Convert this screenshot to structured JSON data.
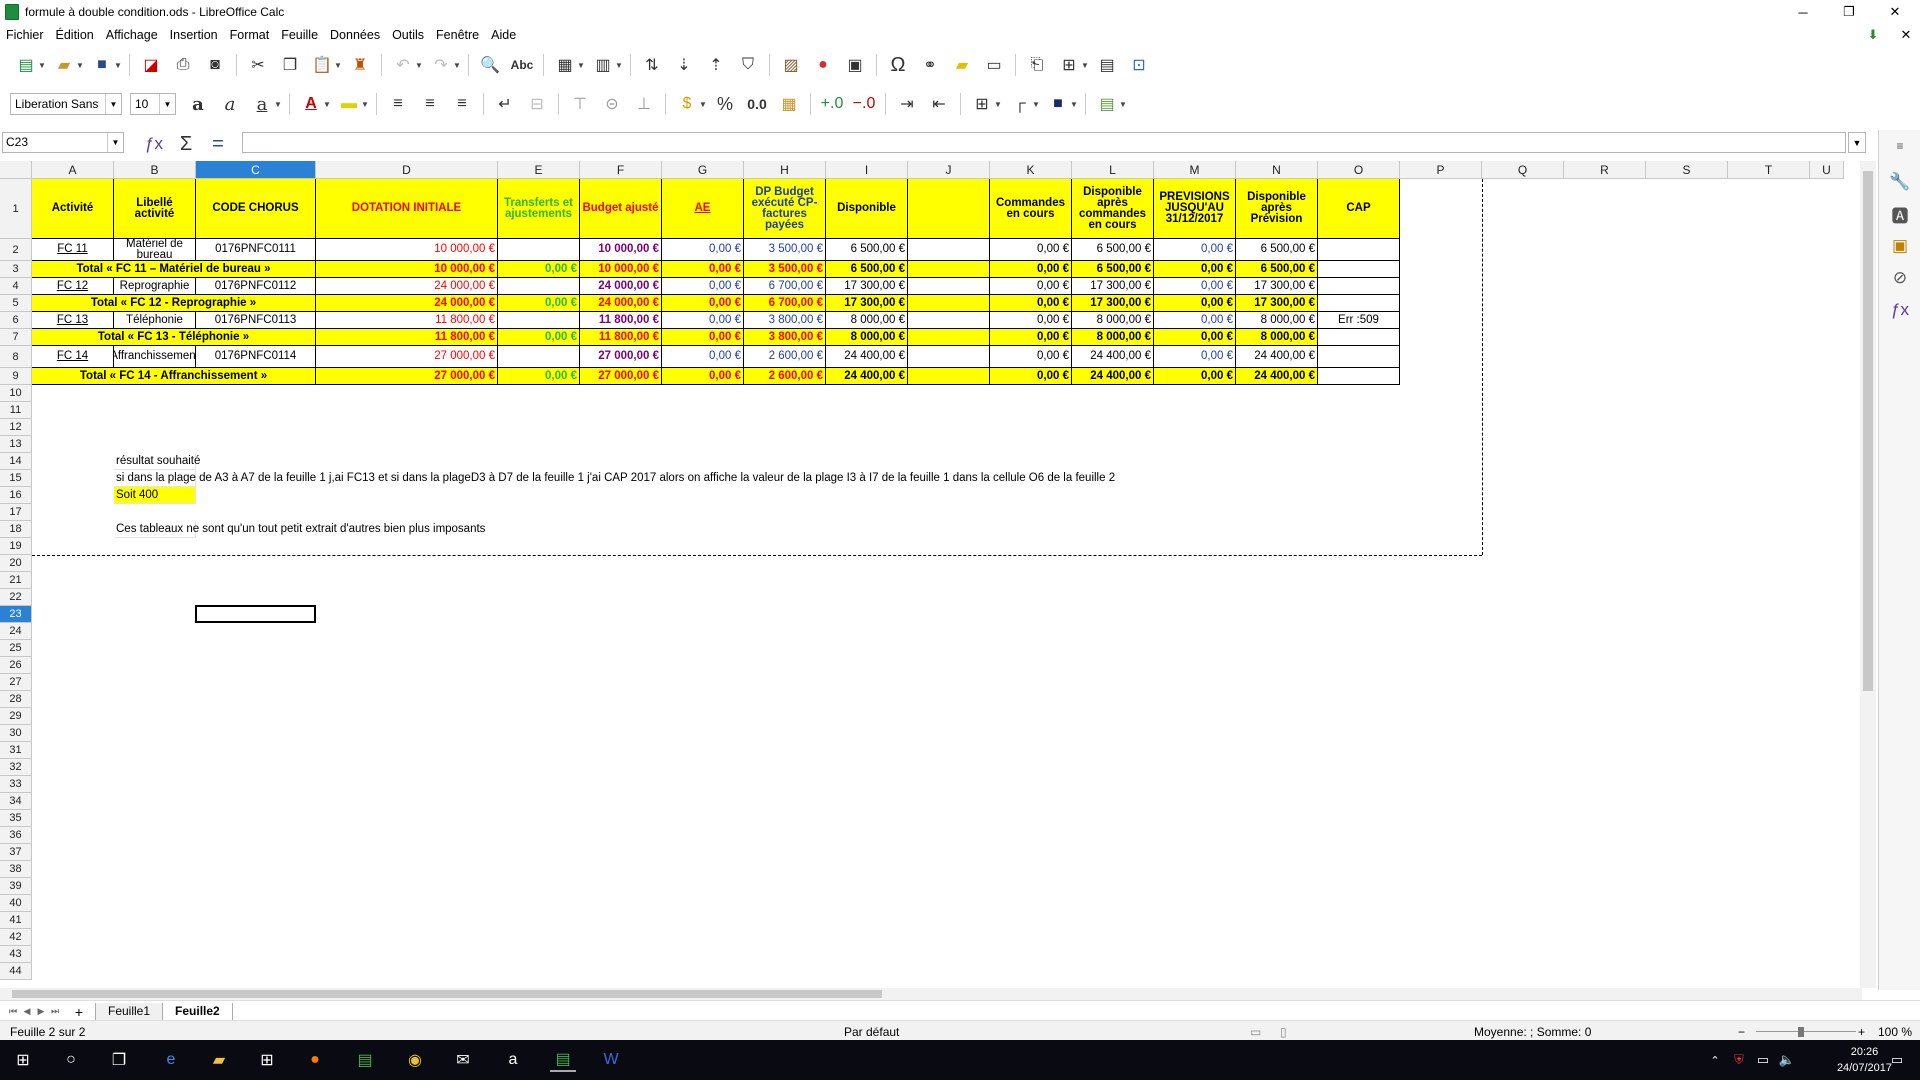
{
  "window": {
    "title": "formule à double condition.ods - LibreOffice Calc"
  },
  "menu": [
    "Fichier",
    "Édition",
    "Affichage",
    "Insertion",
    "Format",
    "Feuille",
    "Données",
    "Outils",
    "Fenêtre",
    "Aide"
  ],
  "toolbar": {
    "font_name": "Liberation Sans",
    "font_size": "10"
  },
  "formula_bar": {
    "cell_ref": "C23",
    "content": ""
  },
  "columns": [
    "A",
    "B",
    "C",
    "D",
    "E",
    "F",
    "G",
    "H",
    "I",
    "J",
    "K",
    "L",
    "M",
    "N",
    "O",
    "P",
    "Q",
    "R",
    "S",
    "T",
    "U"
  ],
  "selected_column": "C",
  "selected_row": "23",
  "rows": [
    "1",
    "2",
    "3",
    "4",
    "5",
    "6",
    "7",
    "8",
    "9",
    "10",
    "11",
    "12",
    "13",
    "14",
    "15",
    "16",
    "17",
    "18",
    "19",
    "20",
    "21",
    "22",
    "23",
    "24",
    "25",
    "26",
    "27",
    "28",
    "29",
    "30",
    "31",
    "32",
    "33",
    "34",
    "35",
    "36",
    "37",
    "38",
    "39",
    "40",
    "41",
    "42",
    "43",
    "44"
  ],
  "headers": {
    "A": "Activité",
    "B": "Libellé activité",
    "C": "CODE CHORUS",
    "D": "DOTATION INITIALE",
    "E": "Transferts et ajustements",
    "F": "Budget ajusté",
    "G": "AE",
    "H": "DP Budget exécuté CP- factures payées",
    "I": "Disponible",
    "K": "Commandes en cours",
    "L": "Disponible après commandes en cours",
    "M": "PREVISIONS JUSQU'AU 31/12/2017",
    "N": "Disponible après Prévision",
    "O": "CAP"
  },
  "data": {
    "r2": {
      "A": "FC 11",
      "B": "Matériel de bureau",
      "C": "0176PNFC0111",
      "D": "10 000,00 €",
      "F": "10 000,00 €",
      "G": "0,00 €",
      "H": "3 500,00 €",
      "I": "6 500,00 €",
      "K": "0,00 €",
      "L": "6 500,00 €",
      "M": "0,00 €",
      "N": "6 500,00 €"
    },
    "r3": {
      "label": "Total « FC 11 – Matériel de bureau »",
      "D": "10 000,00 €",
      "E": "0,00 €",
      "F": "10 000,00 €",
      "G": "0,00 €",
      "H": "3 500,00 €",
      "I": "6 500,00 €",
      "K": "0,00 €",
      "L": "6 500,00 €",
      "M": "0,00 €",
      "N": "6 500,00 €"
    },
    "r4": {
      "A": "FC 12",
      "B": "Reprographie",
      "C": "0176PNFC0112",
      "D": "24 000,00 €",
      "F": "24 000,00 €",
      "G": "0,00 €",
      "H": "6 700,00 €",
      "I": "17 300,00 €",
      "K": "0,00 €",
      "L": "17 300,00 €",
      "M": "0,00 €",
      "N": "17 300,00 €"
    },
    "r5": {
      "label": "Total «  FC 12 - Reprographie »",
      "D": "24 000,00 €",
      "E": "0,00 €",
      "F": "24 000,00 €",
      "G": "0,00 €",
      "H": "6 700,00 €",
      "I": "17 300,00 €",
      "K": "0,00 €",
      "L": "17 300,00 €",
      "M": "0,00 €",
      "N": "17 300,00 €"
    },
    "r6": {
      "A": "FC 13",
      "B": "Téléphonie",
      "C": "0176PNFC0113",
      "D": "11 800,00 €",
      "F": "11 800,00 €",
      "G": "0,00 €",
      "H": "3 800,00 €",
      "I": "8 000,00 €",
      "K": "0,00 €",
      "L": "8 000,00 €",
      "M": "0,00 €",
      "N": "8 000,00 €",
      "O": "Err :509"
    },
    "r7": {
      "label": "Total «  FC 13 - Téléphonie »",
      "D": "11 800,00 €",
      "E": "0,00 €",
      "F": "11 800,00 €",
      "G": "0,00 €",
      "H": "3 800,00 €",
      "I": "8 000,00 €",
      "K": "0,00 €",
      "L": "8 000,00 €",
      "M": "0,00 €",
      "N": "8 000,00 €"
    },
    "r8": {
      "A": "FC 14",
      "B": "Affranchissement",
      "C": "0176PNFC0114",
      "D": "27 000,00 €",
      "F": "27 000,00 €",
      "G": "0,00 €",
      "H": "2 600,00 €",
      "I": "24 400,00 €",
      "K": "0,00 €",
      "L": "24 400,00 €",
      "M": "0,00 €",
      "N": "24 400,00 €"
    },
    "r9": {
      "label": "Total « FC 14 - Affranchissement »",
      "D": "27 000,00 €",
      "E": "0,00 €",
      "F": "27 000,00 €",
      "G": "0,00 €",
      "H": "2 600,00 €",
      "I": "24 400,00 €",
      "K": "0,00 €",
      "L": "24 400,00 €",
      "M": "0,00 €",
      "N": "24 400,00 €"
    },
    "r14": "résultat souhaité",
    "r15": "si dans la plage de A3 à A7  de la feuille 1 j,ai FC13 et si dans la plageD3 à D7 de la feuille 1  j'ai CAP 2017 alors on affiche la valeur de la plage I3 à I7 de la feuille 1 dans la cellule O6 de la feuille 2",
    "r16": "Soit 400",
    "r18": "Ces tableaux ne sont  qu'un tout petit extrait d'autres bien plus imposants"
  },
  "sheets": [
    "Feuille1",
    "Feuille2"
  ],
  "active_sheet": "Feuille2",
  "status": {
    "sheet": "Feuille 2 sur 2",
    "style": "Par défaut",
    "sum": "Moyenne: ; Somme: 0",
    "zoom": "100 %"
  },
  "clock": {
    "time": "20:26",
    "date": "24/07/2017"
  },
  "colors": {
    "highlight": "#ffff00",
    "selection": "#2a81d6",
    "total_green": "#2eb82e",
    "dotation_red": "#ff0000"
  }
}
